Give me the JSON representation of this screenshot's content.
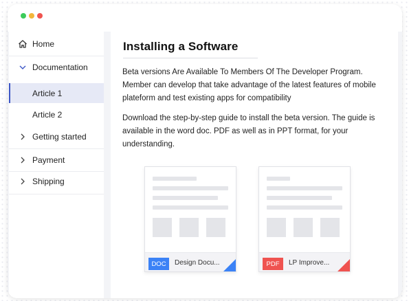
{
  "window": {
    "controls": [
      "close",
      "minimize",
      "maximize"
    ]
  },
  "sidebar": {
    "items": [
      {
        "label": "Home",
        "icon": "home-icon"
      },
      {
        "label": "Documentation",
        "icon": "chevron-down-icon"
      },
      {
        "label": "Article 1",
        "active": true
      },
      {
        "label": "Article 2"
      },
      {
        "label": "Getting started",
        "icon": "chevron-right-icon"
      },
      {
        "label": "Payment",
        "icon": "chevron-right-icon"
      },
      {
        "label": "Shipping",
        "icon": "chevron-right-icon"
      }
    ]
  },
  "article": {
    "title": "Installing a Software",
    "paragraph1": "Beta versions Are Available To Members Of The Developer Program. Member can develop that take advantage of the latest features of mobile plateform and test existing apps for compatibility",
    "paragraph2": "Download the step-by-step guide to install the beta version. The guide is available in the word doc. PDF as well as in PPT format, for your understanding.",
    "files": [
      {
        "type": "DOC",
        "name": "Design Docu...",
        "color": "#3b82f6"
      },
      {
        "type": "PDF",
        "name": "LP Improve...",
        "color": "#ef5350"
      }
    ]
  },
  "colors": {
    "accent": "#3e57c6",
    "active_bg": "#e6e9f6",
    "doc": "#3b82f6",
    "pdf": "#ef5350"
  }
}
